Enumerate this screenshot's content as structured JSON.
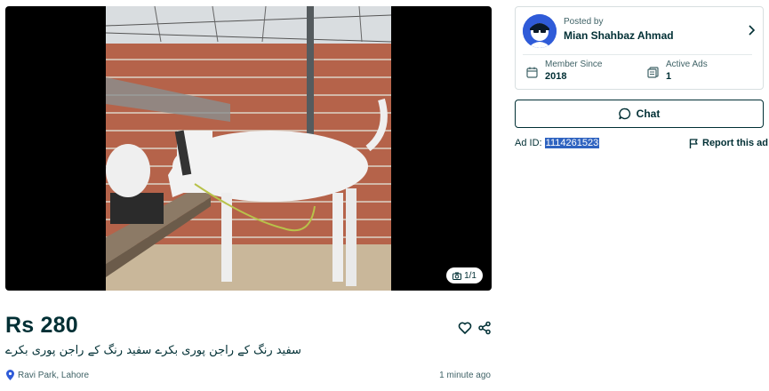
{
  "gallery": {
    "image_description_icon": "goat-photo",
    "counter": "1/1",
    "counter_icon": "camera-icon"
  },
  "listing": {
    "price": "Rs 280",
    "title": "سفید رنگ کے راجن پوری بکرے سفید رنگ کے راجن پوری بکرے",
    "location": "Ravi Park, Lahore",
    "location_icon": "location-pin-icon",
    "posted_time": "1 minute ago",
    "favorite_icon": "heart-icon",
    "share_icon": "share-icon"
  },
  "seller": {
    "posted_by_label": "Posted by",
    "name": "Mian Shahbaz Ahmad",
    "member_since_label": "Member Since",
    "member_since_value": "2018",
    "active_ads_label": "Active Ads",
    "active_ads_value": "1"
  },
  "actions": {
    "chat_label": "Chat",
    "ad_id_label": "Ad ID:",
    "ad_id_value": "1114261523",
    "report_label": "Report this ad"
  },
  "colors": {
    "primary_text": "#002f34",
    "secondary_text": "#406367",
    "selection": "#2f63c0",
    "avatar_bg": "#2f5bd8"
  }
}
